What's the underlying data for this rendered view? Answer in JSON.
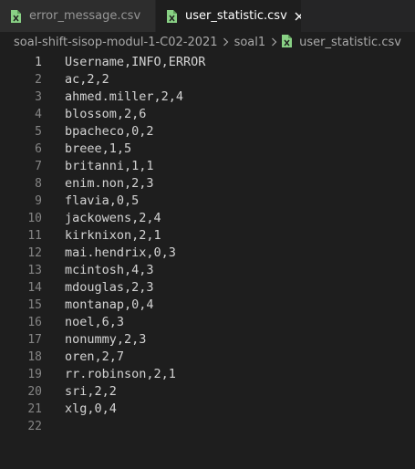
{
  "tabs": [
    {
      "label": "error_message.csv",
      "active": false
    },
    {
      "label": "user_statistic.csv",
      "active": true
    }
  ],
  "breadcrumb": {
    "folder": "soal-shift-sisop-modul-1-C02-2021",
    "subfolder": "soal1",
    "file": "user_statistic.csv"
  },
  "editor": {
    "current_line": 1,
    "lines": [
      {
        "number": "1",
        "text": "Username,INFO,ERROR"
      },
      {
        "number": "2",
        "text": "ac,2,2"
      },
      {
        "number": "3",
        "text": "ahmed.miller,2,4"
      },
      {
        "number": "4",
        "text": "blossom,2,6"
      },
      {
        "number": "5",
        "text": "bpacheco,0,2"
      },
      {
        "number": "6",
        "text": "breee,1,5"
      },
      {
        "number": "7",
        "text": "britanni,1,1"
      },
      {
        "number": "8",
        "text": "enim.non,2,3"
      },
      {
        "number": "9",
        "text": "flavia,0,5"
      },
      {
        "number": "10",
        "text": "jackowens,2,4"
      },
      {
        "number": "11",
        "text": "kirknixon,2,1"
      },
      {
        "number": "12",
        "text": "mai.hendrix,0,3"
      },
      {
        "number": "13",
        "text": "mcintosh,4,3"
      },
      {
        "number": "14",
        "text": "mdouglas,2,3"
      },
      {
        "number": "15",
        "text": "montanap,0,4"
      },
      {
        "number": "16",
        "text": "noel,6,3"
      },
      {
        "number": "17",
        "text": "nonummy,2,3"
      },
      {
        "number": "18",
        "text": "oren,2,7"
      },
      {
        "number": "19",
        "text": "rr.robinson,2,1"
      },
      {
        "number": "20",
        "text": "sri,2,2"
      },
      {
        "number": "21",
        "text": "xlg,0,4"
      },
      {
        "number": "22",
        "text": ""
      }
    ]
  },
  "icons": {
    "tab_file_icon": "csv-file-icon",
    "tab_close_icon": "close-icon",
    "breadcrumb_separator": "chevron-right-icon"
  },
  "colors": {
    "csv_icon": "#89d185",
    "editor_background": "#1e1e1e",
    "tab_bar_background": "#252526",
    "inactive_tab": "#2d2d2d"
  }
}
